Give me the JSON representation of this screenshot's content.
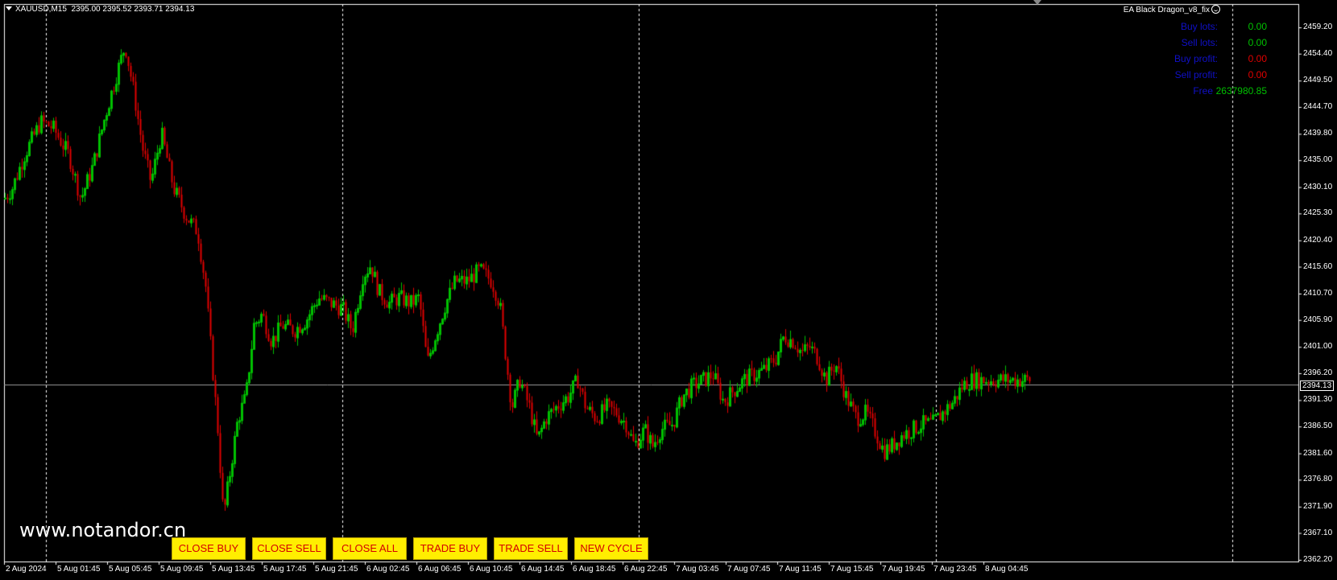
{
  "header": {
    "symbol": "XAUUSD,M15",
    "ohlc": "2395.00 2395.52 2393.71 2394.13"
  },
  "ea_name": "EA Black Dragon_v8_fix",
  "info_panel": [
    {
      "label": "Buy lots:",
      "value": "0.00",
      "value_color": "#00c000"
    },
    {
      "label": "Sell lots:",
      "value": "0.00",
      "value_color": "#00c000"
    },
    {
      "label": "Buy profit:",
      "value": "0.00",
      "value_color": "#e00000"
    },
    {
      "label": "Sell profit:",
      "value": "0.00",
      "value_color": "#e00000"
    },
    {
      "label": "Free",
      "value": "2637980.85",
      "value_color": "#00c000"
    }
  ],
  "watermark": "www.notandor.cn",
  "buttons": [
    {
      "label": "CLOSE BUY"
    },
    {
      "label": "CLOSE SELL"
    },
    {
      "label": "CLOSE ALL"
    },
    {
      "label": "TRADE BUY"
    },
    {
      "label": "TRADE SELL"
    },
    {
      "label": "NEW CYCLE"
    }
  ],
  "current_price": "2394.13",
  "colors": {
    "background": "#000000",
    "bull": "#00c000",
    "bear": "#e00000",
    "grid": "#ffffff",
    "bid_line": "#a0a0a0",
    "button_bg": "#ffee00",
    "button_text": "#d40000"
  },
  "chart_data": {
    "type": "candlestick",
    "y_axis_ticks": [
      "2459.20",
      "2454.40",
      "2449.50",
      "2444.70",
      "2439.80",
      "2435.00",
      "2430.10",
      "2425.30",
      "2420.40",
      "2415.60",
      "2410.70",
      "2405.90",
      "2401.00",
      "2396.20",
      "2391.30",
      "2386.50",
      "2381.60",
      "2376.80",
      "2371.90",
      "2367.10",
      "2362.20"
    ],
    "x_axis_ticks": [
      "2 Aug 2024",
      "5 Aug 01:45",
      "5 Aug 05:45",
      "5 Aug 09:45",
      "5 Aug 13:45",
      "5 Aug 17:45",
      "5 Aug 21:45",
      "6 Aug 02:45",
      "6 Aug 06:45",
      "6 Aug 10:45",
      "6 Aug 14:45",
      "6 Aug 18:45",
      "6 Aug 22:45",
      "7 Aug 03:45",
      "7 Aug 07:45",
      "7 Aug 11:45",
      "7 Aug 15:45",
      "7 Aug 19:45",
      "7 Aug 23:45",
      "8 Aug 04:45"
    ],
    "ylim": [
      2362.2,
      2459.2
    ],
    "series_close_path": [
      [
        0,
        2428
      ],
      [
        10,
        2430
      ],
      [
        25,
        2436
      ],
      [
        45,
        2442
      ],
      [
        60,
        2441
      ],
      [
        80,
        2436
      ],
      [
        95,
        2428
      ],
      [
        110,
        2434
      ],
      [
        125,
        2443
      ],
      [
        140,
        2451
      ],
      [
        150,
        2456
      ],
      [
        160,
        2448
      ],
      [
        172,
        2437
      ],
      [
        182,
        2431
      ],
      [
        195,
        2440
      ],
      [
        210,
        2430
      ],
      [
        225,
        2425
      ],
      [
        240,
        2422
      ],
      [
        250,
        2412
      ],
      [
        258,
        2398
      ],
      [
        265,
        2386
      ],
      [
        272,
        2370
      ],
      [
        280,
        2378
      ],
      [
        290,
        2388
      ],
      [
        300,
        2392
      ],
      [
        310,
        2405
      ],
      [
        320,
        2407
      ],
      [
        332,
        2402
      ],
      [
        345,
        2405
      ],
      [
        360,
        2404
      ],
      [
        375,
        2406
      ],
      [
        390,
        2410
      ],
      [
        405,
        2409
      ],
      [
        420,
        2408
      ],
      [
        432,
        2404
      ],
      [
        445,
        2414
      ],
      [
        455,
        2416
      ],
      [
        465,
        2411
      ],
      [
        478,
        2409
      ],
      [
        490,
        2410
      ],
      [
        505,
        2409
      ],
      [
        515,
        2410
      ],
      [
        525,
        2398
      ],
      [
        535,
        2403
      ],
      [
        548,
        2409
      ],
      [
        560,
        2413
      ],
      [
        575,
        2413
      ],
      [
        590,
        2415
      ],
      [
        605,
        2413
      ],
      [
        615,
        2409
      ],
      [
        622,
        2400
      ],
      [
        630,
        2390
      ],
      [
        640,
        2395
      ],
      [
        652,
        2390
      ],
      [
        662,
        2384
      ],
      [
        672,
        2388
      ],
      [
        685,
        2390
      ],
      [
        700,
        2392
      ],
      [
        712,
        2395
      ],
      [
        722,
        2390
      ],
      [
        735,
        2388
      ],
      [
        748,
        2390
      ],
      [
        760,
        2389
      ],
      [
        772,
        2387
      ],
      [
        782,
        2383
      ],
      [
        795,
        2386
      ],
      [
        805,
        2383
      ],
      [
        815,
        2386
      ],
      [
        830,
        2387
      ],
      [
        842,
        2392
      ],
      [
        855,
        2394
      ],
      [
        868,
        2395
      ],
      [
        880,
        2396
      ],
      [
        893,
        2391
      ],
      [
        905,
        2393
      ],
      [
        918,
        2395
      ],
      [
        932,
        2396
      ],
      [
        945,
        2397
      ],
      [
        958,
        2399
      ],
      [
        968,
        2403
      ],
      [
        980,
        2402
      ],
      [
        990,
        2400
      ],
      [
        1000,
        2401
      ],
      [
        1010,
        2399
      ],
      [
        1020,
        2395
      ],
      [
        1032,
        2398
      ],
      [
        1045,
        2392
      ],
      [
        1058,
        2388
      ],
      [
        1070,
        2389
      ],
      [
        1080,
        2386
      ],
      [
        1092,
        2382
      ],
      [
        1102,
        2383
      ],
      [
        1115,
        2385
      ],
      [
        1128,
        2386
      ],
      [
        1140,
        2387
      ],
      [
        1152,
        2387
      ],
      [
        1165,
        2389
      ],
      [
        1178,
        2391
      ],
      [
        1190,
        2394
      ],
      [
        1200,
        2395
      ],
      [
        1212,
        2395
      ]
    ]
  }
}
